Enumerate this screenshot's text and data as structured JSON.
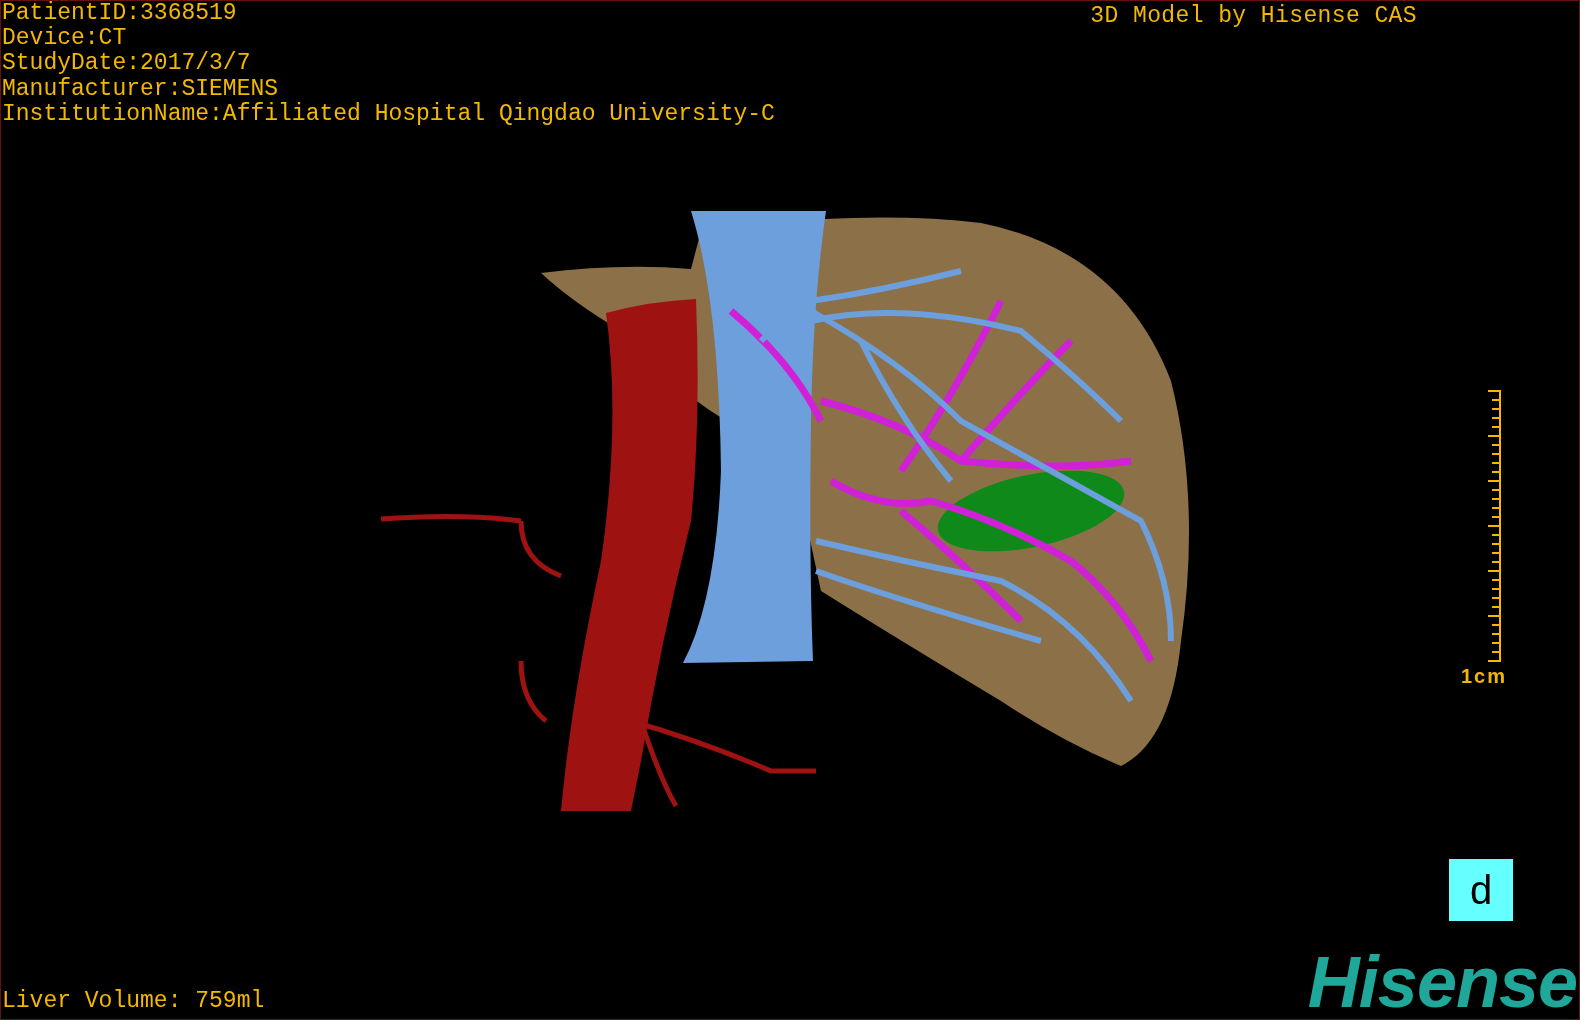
{
  "patient_info": [
    "PatientID:3368519",
    "Device:CT",
    "StudyDate:2017/3/7",
    "Manufacturer:SIEMENS",
    "InstitutionName:Affiliated Hospital Qingdao University-C"
  ],
  "title": "3D Model by Hisense CAS",
  "scale": {
    "label": "1cm"
  },
  "view_marker": "d",
  "logo": "Hisense",
  "volume": "Liver Volume: 759ml"
}
